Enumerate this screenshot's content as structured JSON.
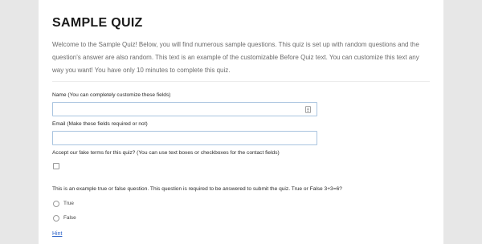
{
  "quiz": {
    "title": "SAMPLE QUIZ",
    "intro": "Welcome to the Sample Quiz! Below, you will find numerous sample questions. This quiz is set up with random questions and the question's answer are also random. This text is an example of the customizable Before Quiz text. You can customize this text any way you want! You have only 10 minutes to complete this quiz."
  },
  "contact": {
    "name_label": "Name (You can completely customize these fields)",
    "name_value": "",
    "email_label": "Email (Make these fields required or not)",
    "email_value": "",
    "terms_label": "Accept our fake terms for this quiz? (You can use text boxes or checkboxes for the contact fields)",
    "terms_checked": false,
    "autofill_icon": "contact-card-icon"
  },
  "question": {
    "text": "This is an example true or false question. This question is required to be answered to submit the quiz. True or False 3+3=6?",
    "options": [
      {
        "label": "True"
      },
      {
        "label": "False"
      }
    ],
    "hint_label": "Hint"
  },
  "colors": {
    "background": "#e7e7e7",
    "card": "#ffffff",
    "input_border": "#a9c4df",
    "link": "#2d63c8",
    "intro_text": "#6b6b6b"
  }
}
